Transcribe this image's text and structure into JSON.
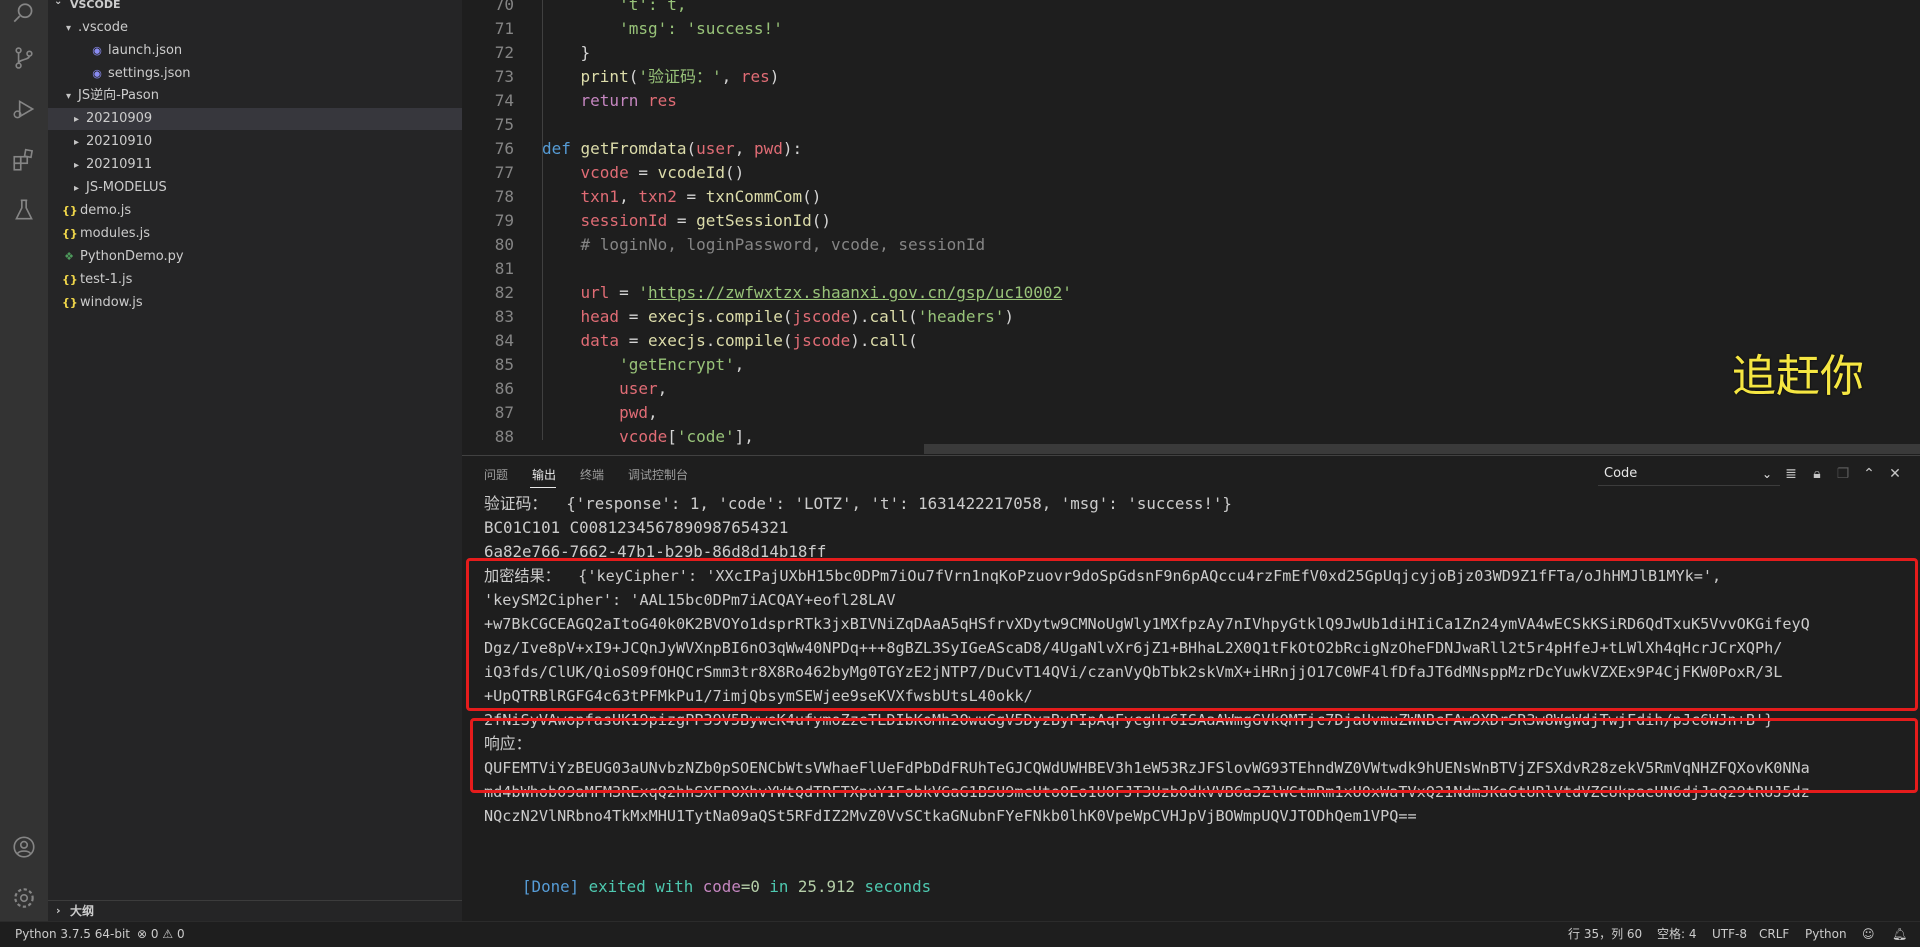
{
  "explorer": {
    "title": "VSCODE",
    "items": [
      {
        "label": ".vscode",
        "type": "folder",
        "expanded": true
      },
      {
        "label": "launch.json",
        "type": "json"
      },
      {
        "label": "settings.json",
        "type": "json"
      },
      {
        "label": "JS逆向-Pason",
        "type": "folder",
        "expanded": true
      },
      {
        "label": "20210909",
        "type": "folder",
        "selected": true
      },
      {
        "label": "20210910",
        "type": "folder"
      },
      {
        "label": "20210911",
        "type": "folder"
      },
      {
        "label": "JS-MODELUS",
        "type": "folder"
      },
      {
        "label": "demo.js",
        "type": "js"
      },
      {
        "label": "modules.js",
        "type": "js"
      },
      {
        "label": "PythonDemo.py",
        "type": "py"
      },
      {
        "label": "test-1.js",
        "type": "js"
      },
      {
        "label": "window.js",
        "type": "js"
      }
    ],
    "outline_label": "大纲"
  },
  "editor": {
    "lines": [
      {
        "n": "70",
        "tokens": [
          [
            "str",
            "        't': t,"
          ]
        ]
      },
      {
        "n": "71",
        "tokens": [
          [
            "str",
            "        'msg': 'success!'"
          ]
        ]
      },
      {
        "n": "72",
        "tokens": [
          [
            "pl",
            "    }"
          ]
        ]
      },
      {
        "n": "73",
        "tokens": [
          [
            "pl",
            "    "
          ],
          [
            "fn",
            "print"
          ],
          [
            "pl",
            "("
          ],
          [
            "str",
            "'验证码：'"
          ],
          [
            "pl",
            ", "
          ],
          [
            "var",
            "res"
          ],
          [
            "pl",
            ")"
          ]
        ]
      },
      {
        "n": "74",
        "tokens": [
          [
            "pl",
            "    "
          ],
          [
            "kw",
            "return"
          ],
          [
            "pl",
            " "
          ],
          [
            "var",
            "res"
          ]
        ]
      },
      {
        "n": "75",
        "tokens": []
      },
      {
        "n": "76",
        "tokens": [
          [
            "kw2",
            "def"
          ],
          [
            "pl",
            " "
          ],
          [
            "fn",
            "getFromdata"
          ],
          [
            "pl",
            "("
          ],
          [
            "var",
            "user"
          ],
          [
            "pl",
            ", "
          ],
          [
            "var",
            "pwd"
          ],
          [
            "pl",
            "):"
          ]
        ]
      },
      {
        "n": "77",
        "tokens": [
          [
            "pl",
            "    "
          ],
          [
            "var",
            "vcode"
          ],
          [
            "pl",
            " = "
          ],
          [
            "fn",
            "vcodeId"
          ],
          [
            "pl",
            "()"
          ]
        ]
      },
      {
        "n": "78",
        "tokens": [
          [
            "pl",
            "    "
          ],
          [
            "var",
            "txn1"
          ],
          [
            "pl",
            ", "
          ],
          [
            "var",
            "txn2"
          ],
          [
            "pl",
            " = "
          ],
          [
            "fn",
            "txnCommCom"
          ],
          [
            "pl",
            "()"
          ]
        ]
      },
      {
        "n": "79",
        "tokens": [
          [
            "pl",
            "    "
          ],
          [
            "var",
            "sessionId"
          ],
          [
            "pl",
            " = "
          ],
          [
            "fn",
            "getSessionId"
          ],
          [
            "pl",
            "()"
          ]
        ]
      },
      {
        "n": "80",
        "tokens": [
          [
            "cm",
            "    # loginNo, loginPassword, vcode, sessionId"
          ]
        ]
      },
      {
        "n": "81",
        "tokens": []
      },
      {
        "n": "82",
        "tokens": [
          [
            "pl",
            "    "
          ],
          [
            "var",
            "url"
          ],
          [
            "pl",
            " = "
          ],
          [
            "str",
            "'"
          ],
          [
            "url",
            "https://zwfwxtzx.shaanxi.gov.cn/gsp/uc10002"
          ],
          [
            "str",
            "'"
          ]
        ]
      },
      {
        "n": "83",
        "tokens": [
          [
            "pl",
            "    "
          ],
          [
            "var",
            "head"
          ],
          [
            "pl",
            " = "
          ],
          [
            "fn",
            "execjs"
          ],
          [
            "pl",
            "."
          ],
          [
            "fn",
            "compile"
          ],
          [
            "pl",
            "("
          ],
          [
            "var",
            "jscode"
          ],
          [
            "pl",
            ")."
          ],
          [
            "fn",
            "call"
          ],
          [
            "pl",
            "("
          ],
          [
            "str",
            "'headers'"
          ],
          [
            "pl",
            ")"
          ]
        ]
      },
      {
        "n": "84",
        "tokens": [
          [
            "pl",
            "    "
          ],
          [
            "var",
            "data"
          ],
          [
            "pl",
            " = "
          ],
          [
            "fn",
            "execjs"
          ],
          [
            "pl",
            "."
          ],
          [
            "fn",
            "compile"
          ],
          [
            "pl",
            "("
          ],
          [
            "var",
            "jscode"
          ],
          [
            "pl",
            ")."
          ],
          [
            "fn",
            "call"
          ],
          [
            "pl",
            "("
          ]
        ]
      },
      {
        "n": "85",
        "tokens": [
          [
            "pl",
            "        "
          ],
          [
            "str",
            "'getEncrypt'"
          ],
          [
            "pl",
            ","
          ]
        ]
      },
      {
        "n": "86",
        "tokens": [
          [
            "pl",
            "        "
          ],
          [
            "var",
            "user"
          ],
          [
            "pl",
            ","
          ]
        ]
      },
      {
        "n": "87",
        "tokens": [
          [
            "pl",
            "        "
          ],
          [
            "var",
            "pwd"
          ],
          [
            "pl",
            ","
          ]
        ]
      },
      {
        "n": "88",
        "tokens": [
          [
            "pl",
            "        "
          ],
          [
            "var",
            "vcode"
          ],
          [
            "pl",
            "["
          ],
          [
            "str",
            "'code'"
          ],
          [
            "pl",
            "],"
          ]
        ]
      }
    ],
    "overlay_caption": "追赶你"
  },
  "panel": {
    "tabs": [
      "问题",
      "输出",
      "终端",
      "调试控制台"
    ],
    "active_tab": "输出",
    "channel": "Code",
    "output_lines": [
      "验证码：  {'response': 1, 'code': 'LOTZ', 't': 1631422217058, 'msg': 'success!'}",
      "BC01C101 C008123456789098765​4321",
      "6a82e766-7662-47b1-b29b-86d8d14b18ff",
      "加密结果：  {'keyCipher': 'XXcIPajUXbH15bc0DPm7iOu7fVrn1nqKoPzuovr9doSpGdsnF9n6pAQccu4rzFmEfV0xd25GpUqjcyjoBjz03WD9Z1fFTa/oJhHMJlB1MYk=',",
      "'keySM2Cipher': 'AAL15bc0DPm7iACQAY+eofl28LAV",
      "+w7BkCGCEAGQ2aItoG40k0K2BVOYo1dsprRTk3jxBIVNiZqDAaA5qHSfrvXDytw9CMNoUgWly1MXfpzAy7nIVhpyGtklQ9JwUb1diHIiCa1Zn24ymVA4wECSkKSiRD6QdTxuK5VvvOKGifeyQ",
      "Dgz/Ive8pV+xI9+JCQnJyWVXnpBI6nO3qWw40NPDq+++8gBZL3SyIGeAScaD8/4UgaNlvXr6jZ1+BHhaL2X0Q1tFkOtO2bRcigNzOheFDNJwaRll2t5r4pHfeJ+tLWlXh4qHcrJCrXQPh/",
      "iQ3fds/ClUK/QioS09fOHQCrSmm3tr8X8Ro462byMg0TGYzE2jNTP7/DuCvT14QVi/czanVyQbTbk2skVmX+iHRnjjO17C0WF4lfDfaJT6dMNsppMzrDcYuwkVZXEx9P4CjFKW0PoxR/3L",
      "+UpQTRBlRGFG4c63tPFMkPu1/7imjQbsymSEWjee9seKVXfwsbUtsL40okk/",
      "2fNiSyVAwopfasUK19pizgPP39V5ByweK4ufymoZzeTLDIbKoMh2OwuGgV5DyzByPIpAqFycgHr6ISAaAWmgGVkQMTjc7DjaUvmuZWNBcFAw9XDrSR3w8WgWdjTwjFdih/pJc6WJn+B'}",
      "响应：",
      "QUFEMTViYzBEUG03aUNvbzNZb0pSOENCbWtsVWhaeFlUeFdPbDdFRUhTeGJCQWdUWHBEV3h1eW53RzJFSlovWG93TEhndWZ0VWtwdk9hUENsWnBTVjZFSXdvR28zekV5RmVqNHZFQXovK0NNa",
      "md4bWhob09aMFM3RExqQ2hhSXFPOXhvYWtQdTRFTXpuY1FobkVGaG1BSU9mcUtoOEo1U0FJT3Uzb0dkVVB6a3ZlWCtmRm1xU0xWaTVxQ21NdmJKaGtURlVtdVZCUkpaeUN6djJaQ29tRUJ5dz",
      "NQczN2VlNRbno4TkMxMHU1TytNa09aQSt5RFdIZ2MvZ0VvSCtkaGNubnFYeFNkb0lhK0VpeWpCVHJpVjBOWmpUQVJTODhQem1VPQ=="
    ],
    "done": {
      "label": "[Done]",
      "text1": "exited with",
      "code_kw": "code",
      "code_val": "=0",
      "text2": "in",
      "seconds": "25.912",
      "text3": "seconds"
    }
  },
  "statusbar": {
    "interpreter": "Python 3.7.5 64-bit",
    "errors": "0",
    "warnings": "0",
    "position": "行 35，列 60",
    "spaces": "空格: 4",
    "encoding": "UTF-8",
    "eol": "CRLF",
    "language": "Python"
  }
}
